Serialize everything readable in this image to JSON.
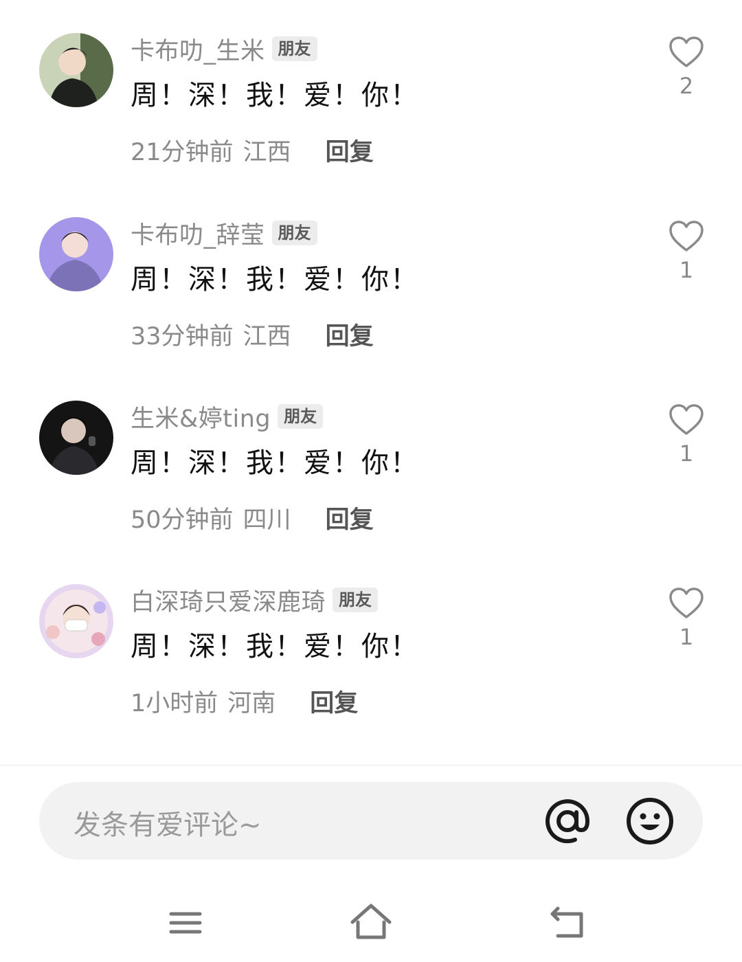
{
  "comments": [
    {
      "name": "卡布叻_生米",
      "badge": "朋友",
      "text": "周！深！我！爱！你！",
      "time": "21分钟前",
      "location": "江西",
      "reply": "回复",
      "likes": "2",
      "avatar_color": "#2b2f2a"
    },
    {
      "name": "卡布叻_辞莹",
      "badge": "朋友",
      "text": "周！深！我！爱！你！",
      "time": "33分钟前",
      "location": "江西",
      "reply": "回复",
      "likes": "1",
      "avatar_color": "#9a8be0"
    },
    {
      "name": "生米&婷ting",
      "badge": "朋友",
      "text": "周！深！我！爱！你！",
      "time": "50分钟前",
      "location": "四川",
      "reply": "回复",
      "likes": "1",
      "avatar_color": "#1a1a1a"
    },
    {
      "name": "白深琦只爱深鹿琦",
      "badge": "朋友",
      "text": "周！深！我！爱！你！",
      "time": "1小时前",
      "location": "河南",
      "reply": "回复",
      "likes": "1",
      "avatar_color": "#d9c4e6"
    }
  ],
  "input": {
    "placeholder": "发条有爱评论~"
  },
  "icons": {
    "like": "heart-outline-icon",
    "mention": "at-icon",
    "emoji": "smiley-icon",
    "nav": [
      "menu-icon",
      "home-icon",
      "back-icon"
    ]
  }
}
